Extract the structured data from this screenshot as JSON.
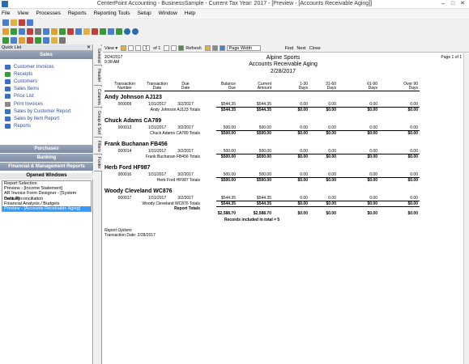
{
  "window": {
    "title": "CenterPoint Accounting - BusinessSample - Current Tax Year: 2017 - [Preview - [Accounts Receivable Aging]]",
    "min": "–",
    "max": "□",
    "close": "✕"
  },
  "menu": [
    "File",
    "View",
    "Processes",
    "Reports",
    "Reporting Tools",
    "Setup",
    "Window",
    "Help"
  ],
  "quick_list": {
    "header": "Quick List",
    "close": "✕",
    "sales_title": "Sales",
    "items": [
      "Customer Invoices",
      "Receipts",
      "Customers",
      "Sales Items",
      "Price List",
      "Print Invoices",
      "Sales by Customer Report",
      "Sales by Item Report",
      "Reports"
    ],
    "sections": [
      "Purchases",
      "Banking",
      "Financial & Management Reports"
    ],
    "opened_title": "Opened Windows",
    "opened": [
      "Report Selection",
      "Preview - [Income Statement]",
      "AR Invoice Form Designer - [System Default]",
      "Bank Reconciliation",
      "Financial Analysis / Budgets",
      "Preview - [Accounts Receivable Aging]"
    ]
  },
  "side_tabs": [
    "General",
    "Header",
    "Columns",
    "Group & Sort",
    "Filters",
    "Footer"
  ],
  "preview_toolbar": {
    "view": "View ▾",
    "page": "1",
    "of": "of 1",
    "refresh": "Refresh",
    "zoom": "Page Width",
    "find": "Find",
    "next": "Next",
    "close": "Close"
  },
  "report": {
    "date": "2/24/2017",
    "time": "9:38 AM",
    "company": "Alpine Sports",
    "title": "Accounts Receivable Aging",
    "as_of": "2/28/2017",
    "page": "Page 1 of 1",
    "headers": [
      [
        "Transaction",
        "Number"
      ],
      [
        "Transaction",
        "Date"
      ],
      [
        "Due",
        "Date"
      ],
      [
        "Balance",
        "Due"
      ],
      [
        "Current",
        "Amount"
      ],
      [
        "1-30",
        "Days"
      ],
      [
        "31-60",
        "Days"
      ],
      [
        "61-90",
        "Days"
      ],
      [
        "Over 90",
        "Days"
      ]
    ],
    "groups": [
      {
        "name": "Andy Johnson AJ123",
        "row": [
          "000009",
          "1/31/2017",
          "3/2/2017",
          "$544.35",
          "$544.35",
          "0.00",
          "0.00",
          "0.00",
          "0.00"
        ],
        "total_label": "Andy Johnson   AJ123 Totals",
        "totals": [
          "$544.35",
          "$544.35",
          "$0.00",
          "$0.00",
          "$0.00",
          "$0.00"
        ]
      },
      {
        "name": "Chuck Adams CA789",
        "row": [
          "000013",
          "1/31/2017",
          "3/2/2017",
          "500.00",
          "500.00",
          "0.00",
          "0.00",
          "0.00",
          "0.00"
        ],
        "total_label": "Chuck Adams   CA789 Totals",
        "totals": [
          "$500.00",
          "$500.00",
          "$0.00",
          "$0.00",
          "$0.00",
          "$0.00"
        ]
      },
      {
        "name": "Frank Buchanan FB456",
        "row": [
          "000014",
          "1/31/2017",
          "3/2/2017",
          "500.00",
          "500.00",
          "0.00",
          "0.00",
          "0.00",
          "0.00"
        ],
        "total_label": "Frank Buchanan   FB456 Totals",
        "totals": [
          "$500.00",
          "$500.00",
          "$0.00",
          "$0.00",
          "$0.00",
          "$0.00"
        ]
      },
      {
        "name": "Herb Ford HF987",
        "row": [
          "000016",
          "1/31/2017",
          "3/2/2017",
          "500.00",
          "500.00",
          "0.00",
          "0.00",
          "0.00",
          "0.00"
        ],
        "total_label": "Herb Ford   HF987 Totals",
        "totals": [
          "$500.00",
          "$500.00",
          "$0.00",
          "$0.00",
          "$0.00",
          "$0.00"
        ]
      },
      {
        "name": "Woody Cleveland WC876",
        "row": [
          "000017",
          "1/31/2017",
          "3/2/2017",
          "$544.35",
          "$544.35",
          "0.00",
          "0.00",
          "0.00",
          "0.00"
        ],
        "total_label": "Woody Cleveland   WC876 Totals",
        "totals": [
          "$544.35",
          "$544.35",
          "$0.00",
          "$0.00",
          "$0.00",
          "$0.00"
        ]
      }
    ],
    "report_totals_label": "Report Totals",
    "report_totals": [
      "$2,588.70",
      "$2,588.70",
      "$0.00",
      "$0.00",
      "$0.00",
      "$0.00"
    ],
    "records": "Records included in total = 5",
    "options_title": "Report Options",
    "options_text": "Transaction Date: 2/28/2017"
  }
}
